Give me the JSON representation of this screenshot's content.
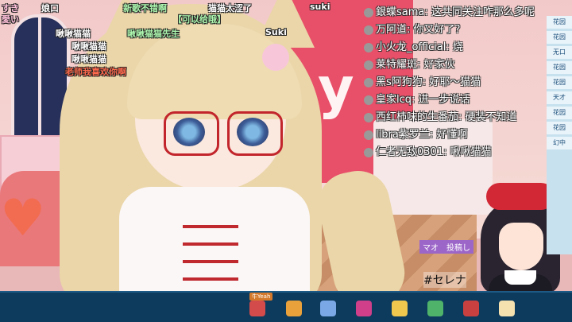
{
  "danmaku": [
    {
      "id": "dm1",
      "text": "すき",
      "color": "pink"
    },
    {
      "id": "dm2",
      "text": "娘口",
      "color": "white"
    },
    {
      "id": "dm3",
      "text": "愛い",
      "color": "pink"
    },
    {
      "id": "dm4",
      "text": "新歌不错啊",
      "color": "green"
    },
    {
      "id": "dm5",
      "text": "猫猫太涩了",
      "color": "white"
    },
    {
      "id": "dm6",
      "text": "【可以给哦】",
      "color": "green"
    },
    {
      "id": "dm7",
      "text": "suki",
      "color": "white"
    },
    {
      "id": "dm8",
      "text": "啾啾猫猫",
      "color": "white"
    },
    {
      "id": "dm9",
      "text": "啾啾猫猫先生",
      "color": "green"
    },
    {
      "id": "dm10",
      "text": "Suki",
      "color": "white"
    },
    {
      "id": "dm11",
      "text": "啾啾猫猫",
      "color": "white"
    },
    {
      "id": "dm12",
      "text": "啾啾猫猫",
      "color": "white"
    },
    {
      "id": "dm13",
      "text": "老师我喜欢你啊",
      "color": "red"
    }
  ],
  "chat": [
    {
      "user": "銀蝶sama",
      "message": "这共同关注咋那么多呢"
    },
    {
      "user": "万阿道",
      "message": "你又好了？"
    },
    {
      "user": "小火龙_official",
      "message": "烧"
    },
    {
      "user": "莱特耀斑",
      "message": "好家伙"
    },
    {
      "user": "黑s阿狗狗",
      "message": "好耶～猫猫"
    },
    {
      "user": "皇家lcq",
      "message": "进一步说话"
    },
    {
      "user": "西红柿味的生番茄",
      "message": "硬装不知道"
    },
    {
      "user": "libra紫罗兰",
      "message": "好懂啊"
    },
    {
      "user": "仁者无敌0301",
      "message": "啾啾猫猫"
    }
  ],
  "overlay": {
    "hashtag": "#セレナ",
    "mao_label": "マオ　投稿し"
  },
  "rail_items": [
    "花园",
    "花园",
    "无口",
    "花园",
    "花园",
    "天才",
    "花园",
    "花园",
    "幻中"
  ],
  "gifts": [
    {
      "badge": "牛Yeah",
      "color": "#d44b4b"
    },
    {
      "badge": "",
      "color": "#e9a13b"
    },
    {
      "badge": "",
      "color": "#7aa8e6"
    },
    {
      "badge": "",
      "color": "#cf3f8a"
    },
    {
      "badge": "",
      "color": "#f0c84e"
    },
    {
      "badge": "",
      "color": "#4fb36a"
    },
    {
      "badge": "",
      "color": "#c94040"
    },
    {
      "badge": "",
      "color": "#f5e1b0"
    }
  ],
  "colors": {
    "bottom_bar": "#0d3b5e",
    "glasses": "#c2262c",
    "danmaku_green": "#aef9b0",
    "danmaku_red": "#ff6a4d"
  }
}
